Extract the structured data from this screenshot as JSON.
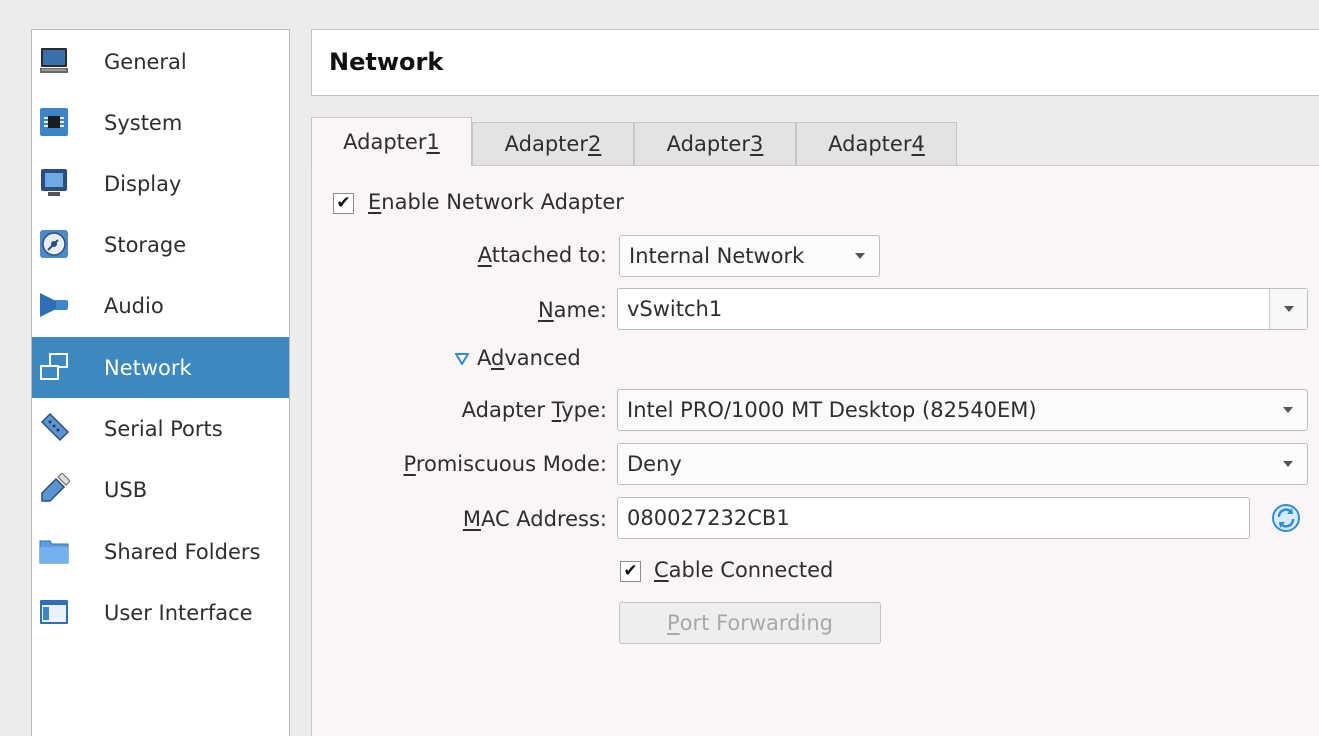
{
  "sidebar": {
    "items": [
      {
        "label": "General",
        "icon": "monitor-icon"
      },
      {
        "label": "System",
        "icon": "chip-icon"
      },
      {
        "label": "Display",
        "icon": "display-icon"
      },
      {
        "label": "Storage",
        "icon": "disc-icon"
      },
      {
        "label": "Audio",
        "icon": "speaker-icon"
      },
      {
        "label": "Network",
        "icon": "network-icon",
        "selected": true
      },
      {
        "label": "Serial Ports",
        "icon": "serial-port-icon"
      },
      {
        "label": "USB",
        "icon": "usb-icon"
      },
      {
        "label": "Shared Folders",
        "icon": "folder-icon"
      },
      {
        "label": "User Interface",
        "icon": "window-icon"
      }
    ]
  },
  "header": {
    "title": "Network"
  },
  "tabs": [
    {
      "pre": "Adapter ",
      "key": "1",
      "active": true
    },
    {
      "pre": "Adapter ",
      "key": "2"
    },
    {
      "pre": "Adapter ",
      "key": "3"
    },
    {
      "pre": "Adapter ",
      "key": "4"
    }
  ],
  "adapter": {
    "enable": {
      "checked": true,
      "key": "E",
      "rest": "nable Network Adapter"
    },
    "attached_to": {
      "key": "A",
      "rest": "ttached to:",
      "value": "Internal Network"
    },
    "name": {
      "key": "N",
      "rest": "ame:",
      "value": "vSwitch1"
    },
    "advanced": {
      "pre": "A",
      "key": "d",
      "rest": "vanced",
      "expanded": true
    },
    "adapter_type": {
      "pre": "Adapter ",
      "key": "T",
      "rest": "ype:",
      "value": "Intel PRO/1000 MT Desktop (82540EM)"
    },
    "promiscuous": {
      "key": "P",
      "rest": "romiscuous Mode:",
      "value": "Deny"
    },
    "mac": {
      "key": "M",
      "rest": "AC Address:",
      "value": "080027232CB1"
    },
    "cable": {
      "checked": true,
      "key": "C",
      "rest": "able Connected"
    },
    "port_forwarding": {
      "key": "P",
      "rest": "ort Forwarding",
      "enabled": false
    }
  },
  "colors": {
    "selection": "#3d88c0",
    "panel": "#fbf6f6",
    "accent_arrow": "#2f8fd6"
  }
}
